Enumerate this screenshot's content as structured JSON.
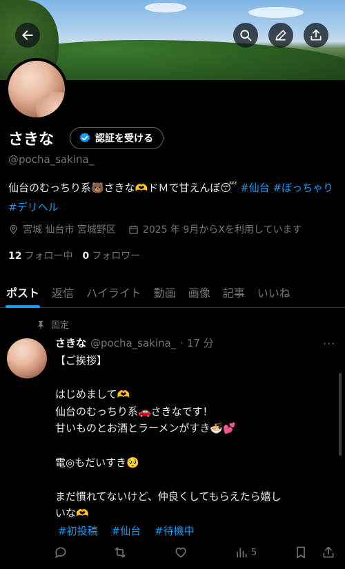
{
  "profile": {
    "name": "さきな",
    "verify_button": "認証を受ける",
    "handle": "@pocha_sakina_",
    "bio_prefix": "仙台のむっちり系🐻さきな🫶ドＭで甘えんぼ😴 ",
    "bio_tags": [
      "#仙台",
      "#ぼっちゃり",
      "#デリヘル"
    ],
    "location": "宮城 仙台市 宮城野区",
    "joined": "2025 年 9月からXを利用しています",
    "following_count": "12",
    "following_label": "フォロー中",
    "followers_count": "0",
    "followers_label": "フォロワー"
  },
  "header_icons": [
    "back-arrow-icon",
    "search-icon",
    "edit-pen-icon",
    "share-upload-icon"
  ],
  "tabs": [
    "ポスト",
    "返信",
    "ハイライト",
    "動画",
    "画像",
    "記事",
    "いいね"
  ],
  "active_tab": "ポスト",
  "post": {
    "pinned_label": "固定",
    "author_name": "さきな",
    "author_handle": "@pocha_sakina_",
    "time": "· 17 分",
    "body": "【ご挨拶】\n\nはじめまして🫶\n仙台のむっちり系🚗さきなです！\n甘いものとお酒とラーメンがすき🍜💕\n\n電◎もだいすき🥺\n\nまだ慣れてないけど、仲良くしてもらえたら嬉し\nいな🫶",
    "tags": [
      "#初投稿",
      "#仙台",
      "#待機中"
    ],
    "views": "5"
  },
  "colors": {
    "accent": "#1d9bf0",
    "background": "#000000",
    "muted": "#71767b",
    "text": "#e7e9ea"
  }
}
